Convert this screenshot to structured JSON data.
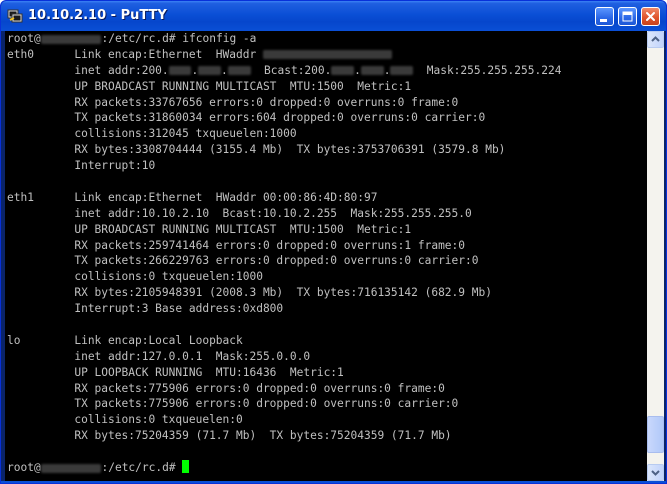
{
  "window": {
    "title": "10.10.2.10 - PuTTY",
    "buttons": {
      "minimize": "minimize-icon",
      "maximize": "maximize-icon",
      "close": "close-icon"
    }
  },
  "terminal": {
    "colors": {
      "background": "#000000",
      "text": "#c0c0c0",
      "cursor": "#00ff00"
    },
    "lines": [
      {
        "segments": [
          {
            "text": "root@"
          },
          {
            "redacted": true,
            "chars": 8
          },
          {
            "text": ":/etc/rc.d# ifconfig -a"
          }
        ]
      },
      {
        "segments": [
          {
            "text": "eth0      Link encap:Ethernet  HWaddr "
          },
          {
            "redacted": true,
            "chars": 17
          }
        ]
      },
      {
        "segments": [
          {
            "text": "          inet addr:200."
          },
          {
            "redacted": true,
            "chars": 3
          },
          {
            "text": "."
          },
          {
            "redacted": true,
            "chars": 3
          },
          {
            "text": "."
          },
          {
            "redacted": true,
            "chars": 3
          },
          {
            "text": "  Bcast:200."
          },
          {
            "redacted": true,
            "chars": 3
          },
          {
            "text": "."
          },
          {
            "redacted": true,
            "chars": 3
          },
          {
            "text": "."
          },
          {
            "redacted": true,
            "chars": 3
          },
          {
            "text": "  Mask:255.255.255.224"
          }
        ]
      },
      {
        "segments": [
          {
            "text": "          UP BROADCAST RUNNING MULTICAST  MTU:1500  Metric:1"
          }
        ]
      },
      {
        "segments": [
          {
            "text": "          RX packets:33767656 errors:0 dropped:0 overruns:0 frame:0"
          }
        ]
      },
      {
        "segments": [
          {
            "text": "          TX packets:31860034 errors:604 dropped:0 overruns:0 carrier:0"
          }
        ]
      },
      {
        "segments": [
          {
            "text": "          collisions:312045 txqueuelen:1000"
          }
        ]
      },
      {
        "segments": [
          {
            "text": "          RX bytes:3308704444 (3155.4 Mb)  TX bytes:3753706391 (3579.8 Mb)"
          }
        ]
      },
      {
        "segments": [
          {
            "text": "          Interrupt:10"
          }
        ]
      },
      {
        "segments": [
          {
            "text": ""
          }
        ]
      },
      {
        "segments": [
          {
            "text": "eth1      Link encap:Ethernet  HWaddr 00:00:86:4D:80:97"
          }
        ]
      },
      {
        "segments": [
          {
            "text": "          inet addr:10.10.2.10  Bcast:10.10.2.255  Mask:255.255.255.0"
          }
        ]
      },
      {
        "segments": [
          {
            "text": "          UP BROADCAST RUNNING MULTICAST  MTU:1500  Metric:1"
          }
        ]
      },
      {
        "segments": [
          {
            "text": "          RX packets:259741464 errors:0 dropped:0 overruns:1 frame:0"
          }
        ]
      },
      {
        "segments": [
          {
            "text": "          TX packets:266229763 errors:0 dropped:0 overruns:0 carrier:0"
          }
        ]
      },
      {
        "segments": [
          {
            "text": "          collisions:0 txqueuelen:1000"
          }
        ]
      },
      {
        "segments": [
          {
            "text": "          RX bytes:2105948391 (2008.3 Mb)  TX bytes:716135142 (682.9 Mb)"
          }
        ]
      },
      {
        "segments": [
          {
            "text": "          Interrupt:3 Base address:0xd800"
          }
        ]
      },
      {
        "segments": [
          {
            "text": ""
          }
        ]
      },
      {
        "segments": [
          {
            "text": "lo        Link encap:Local Loopback"
          }
        ]
      },
      {
        "segments": [
          {
            "text": "          inet addr:127.0.0.1  Mask:255.0.0.0"
          }
        ]
      },
      {
        "segments": [
          {
            "text": "          UP LOOPBACK RUNNING  MTU:16436  Metric:1"
          }
        ]
      },
      {
        "segments": [
          {
            "text": "          RX packets:775906 errors:0 dropped:0 overruns:0 frame:0"
          }
        ]
      },
      {
        "segments": [
          {
            "text": "          TX packets:775906 errors:0 dropped:0 overruns:0 carrier:0"
          }
        ]
      },
      {
        "segments": [
          {
            "text": "          collisions:0 txqueuelen:0"
          }
        ]
      },
      {
        "segments": [
          {
            "text": "          RX bytes:75204359 (71.7 Mb)  TX bytes:75204359 (71.7 Mb)"
          }
        ]
      },
      {
        "segments": [
          {
            "text": ""
          }
        ]
      },
      {
        "segments": [
          {
            "text": "root@"
          },
          {
            "redacted": true,
            "chars": 8
          },
          {
            "text": ":/etc/rc.d# "
          }
        ],
        "cursor": true
      }
    ]
  },
  "scrollbar": {
    "position": 0.97,
    "visible_fraction": 0.36
  }
}
